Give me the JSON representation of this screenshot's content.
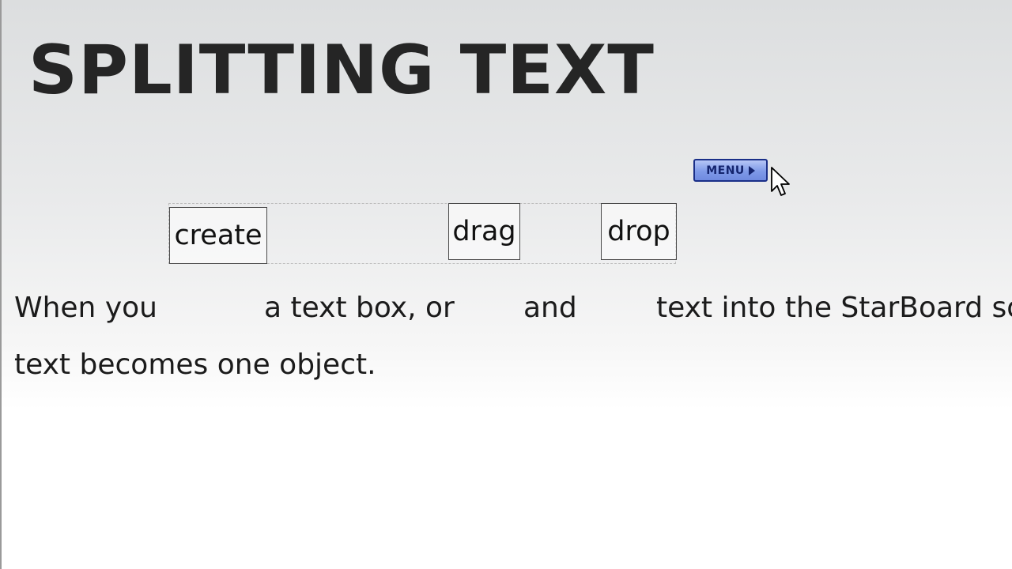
{
  "slide": {
    "title": "SPLITTING TEXT"
  },
  "menu": {
    "label": "MENU",
    "icon": "play-arrow-icon",
    "colors": {
      "fill": "#7f9ae8",
      "border": "#1a2f88",
      "text": "#14246e"
    }
  },
  "word_boxes": {
    "create": "create",
    "drag": "drag",
    "drop": "drop"
  },
  "sentence": {
    "segment_1": "When you",
    "segment_2": "a text box, or",
    "segment_3": "and",
    "segment_4": "text into the StarBoard so",
    "segment_5": "text becomes one object."
  }
}
